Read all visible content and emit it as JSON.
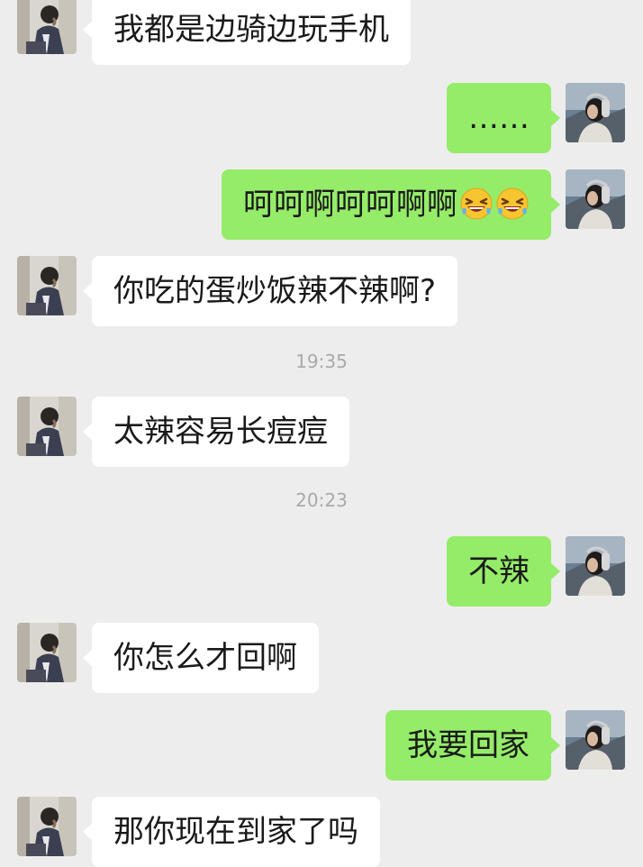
{
  "chat": {
    "messages": [
      {
        "side": "left",
        "text": "我都是边骑边玩手机"
      },
      {
        "side": "right",
        "text": "……"
      },
      {
        "side": "right",
        "text": "呵呵啊呵呵啊啊",
        "emojis": [
          "laughing-tears-emoji",
          "laughing-tears-emoji"
        ]
      },
      {
        "side": "left",
        "text": "你吃的蛋炒饭辣不辣啊?"
      },
      {
        "type": "time",
        "text": "19:35"
      },
      {
        "side": "left",
        "text": "太辣容易长痘痘"
      },
      {
        "type": "time",
        "text": "20:23"
      },
      {
        "side": "right",
        "text": "不辣"
      },
      {
        "side": "left",
        "text": "你怎么才回啊"
      },
      {
        "side": "right",
        "text": "我要回家"
      },
      {
        "side": "left",
        "text": "那你现在到家了吗"
      }
    ]
  },
  "colors": {
    "background": "#ededed",
    "incoming_bubble": "#ffffff",
    "outgoing_bubble": "#95ec69",
    "timestamp": "#a9a9a9"
  }
}
